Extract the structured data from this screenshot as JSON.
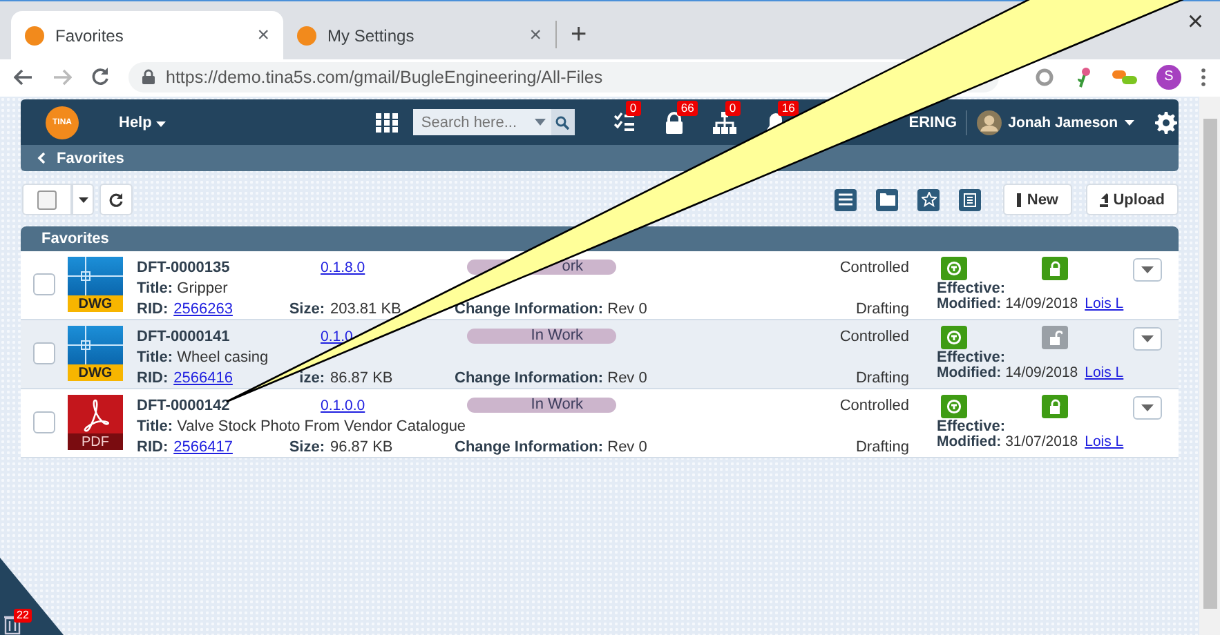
{
  "browser": {
    "tabs": [
      {
        "title": "Favorites",
        "selected": true
      },
      {
        "title": "My Settings",
        "selected": false
      }
    ],
    "new_tab": "+",
    "close": "×",
    "url": "https://demo.tina5s.com/gmail/BugleEngineering/All-Files",
    "profile": "S"
  },
  "nav": {
    "logo": "TINA",
    "help": "Help",
    "search": {
      "placeholder": "Search here..."
    },
    "badges": [
      {
        "kind": "tasks",
        "count": "0"
      },
      {
        "kind": "lock",
        "count": "66"
      },
      {
        "kind": "org",
        "count": "0"
      },
      {
        "kind": "bell",
        "count": "16"
      }
    ],
    "company": "ERING",
    "user": "Jonah Jameson"
  },
  "breadcrumb": "Favorites",
  "toolbar": {
    "select_all": {
      "checked": false
    },
    "new": "New",
    "upload": "Upload"
  },
  "panel": {
    "title": "Favorites",
    "rows": [
      {
        "id": "DFT-0000135",
        "title": "**Title:** Gripper",
        "rid_label": "RID:",
        "rid": "2566263",
        "size_label": "Size:",
        "size": "203.81 KB",
        "version": "0.1.8.0",
        "status": "ork",
        "change": "**Change Information:** Rev 0",
        "control": "Controlled",
        "stage": "Drafting",
        "file": {
          "kind": "dwg",
          "label": "DWG"
        },
        "locked": true,
        "effective": "Effective:",
        "modified": "**Modified:** 14/09/2018",
        "user": "Lois L",
        "checked": false
      },
      {
        "id": "DFT-0000141",
        "title": "**Title:** Wheel casing",
        "rid_label": "RID:",
        "rid": "2566416",
        "size_label": "ize:",
        "size": "86.87 KB",
        "version": "0.1.0",
        "status": "In Work",
        "change": "**Change Information:** Rev 0",
        "control": "Controlled",
        "stage": "Drafting",
        "file": {
          "kind": "dwg",
          "label": "DWG"
        },
        "locked": false,
        "effective": "Effective:",
        "modified": "**Modified:** 14/09/2018",
        "user": "Lois L",
        "checked": false
      },
      {
        "id": "DFT-0000142",
        "title": "**Title:** Valve Stock Photo From Vendor Catalogue",
        "rid_label": "RID:",
        "rid": "2566417",
        "size_label": "Size:",
        "size": "96.87 KB",
        "version": "0.1.0.0",
        "status": "In Work",
        "change": "**Change Information:** Rev 0",
        "control": "Controlled",
        "stage": "Drafting",
        "file": {
          "kind": "pdf",
          "label": "PDF"
        },
        "locked": true,
        "effective": "Effective:",
        "modified": "**Modified:** 31/07/2018",
        "user": "Lois L",
        "checked": false
      }
    ]
  },
  "trash": {
    "count": "22"
  }
}
